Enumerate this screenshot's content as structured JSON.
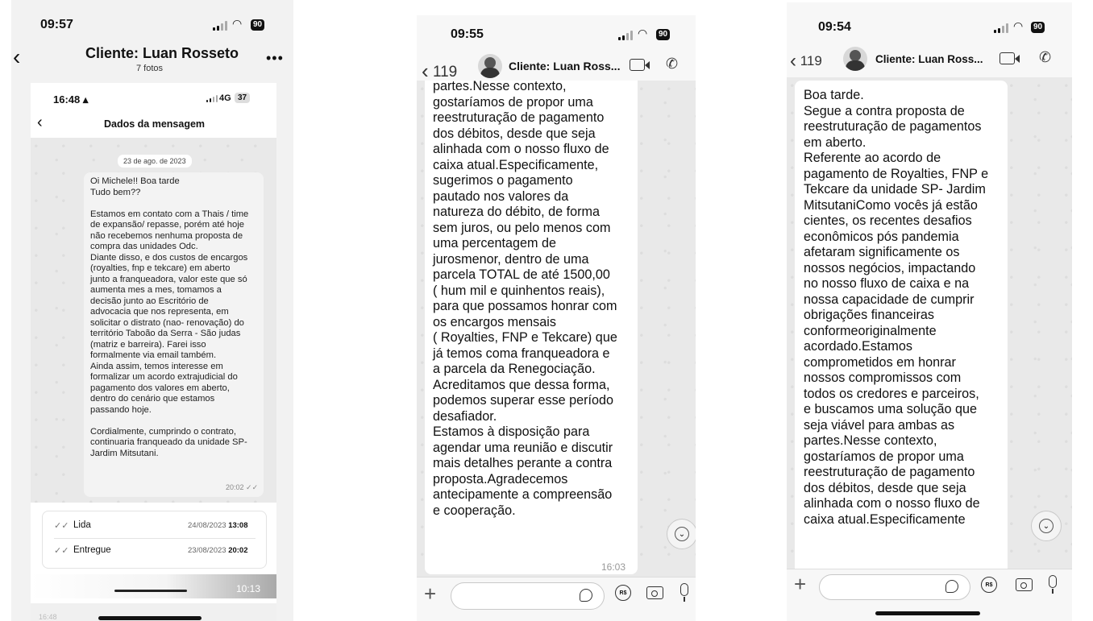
{
  "left": {
    "status_time": "09:57",
    "battery": "90",
    "nav_title": "Cliente: Luan Rosseto",
    "nav_subtitle": "7 fotos",
    "inner": {
      "status_time": "16:48",
      "network": "4G",
      "battery": "37",
      "title": "Dados da mensagem",
      "date_chip": "23 de ago. de 2023",
      "message_lines": [
        "Oi Michele!! Boa tarde",
        "Tudo bem??",
        "",
        "Estamos em contato com a Thais / time",
        "de expansão/ repasse, porém até hoje",
        "não recebemos nenhuma proposta de",
        "compra das unidades Odc.",
        "Diante disso, e dos custos de encargos",
        "(royalties, fnp e tekcare) em aberto",
        "junto a franqueadora, valor este que só",
        "aumenta mes a mes, tomamos a",
        "decisão junto ao Escritório de",
        "advocacia que nos representa, em",
        "solicitar o distrato (nao- renovação) do",
        "território Taboão da Serra - São judas",
        "(matriz e barreira). Farei isso",
        "formalmente via email também.",
        "Ainda assim, temos interesse em",
        "formalizar um acordo extrajudicial do",
        "pagamento dos valores em aberto,",
        "dentro do cenário que estamos",
        "passando hoje.",
        "",
        "Cordialmente, cumprindo o contrato,",
        "continuaria franqueado da unidade SP-",
        "Jardim Mitsutani."
      ],
      "message_time": "20:02",
      "read_label": "Lida",
      "read_date": "24/08/2023",
      "read_time": "13:08",
      "delivered_label": "Entregue",
      "delivered_date": "23/08/2023",
      "delivered_time": "20:02",
      "video_time": "10:13",
      "bottom_time": "16:48"
    }
  },
  "middle": {
    "status_time": "09:55",
    "battery": "90",
    "back_count": "119",
    "contact": "Cliente: Luan Ross...",
    "message_lines": [
      "partes.Nesse contexto,",
      "gostaríamos de propor uma",
      "reestruturação de pagamento",
      "dos débitos, desde que seja",
      "alinhada com o nosso fluxo de",
      "caixa atual.Especificamente,",
      "sugerimos o pagamento",
      "pautado nos valores da",
      "natureza do débito, de forma",
      "sem juros, ou pelo menos com",
      "uma percentagem de",
      "jurosmenor, dentro de uma",
      "parcela TOTAL de até 1500,00",
      "( hum mil e quinhentos reais),",
      "para que possamos honrar com",
      "os encargos mensais",
      "( Royalties, FNP e Tekcare) que",
      "já temos coma franqueadora e",
      "a parcela da Renegociação.",
      "Acreditamos que dessa forma,",
      "podemos superar esse período",
      "desafiador.",
      "Estamos à disposição para",
      "agendar uma reunião e discutir",
      "mais detalhes perante a contra",
      "proposta.Agradecemos",
      "antecipamente a compreensão",
      "e cooperação."
    ],
    "message_time": "16:03"
  },
  "right": {
    "status_time": "09:54",
    "battery": "90",
    "back_count": "119",
    "contact": "Cliente: Luan Ross...",
    "message_lines": [
      "Boa tarde.",
      "Segue a contra proposta de",
      "reestruturação de pagamentos",
      "em aberto.",
      "Referente ao acordo de",
      "pagamento de Royalties, FNP  e",
      "Tekcare da unidade SP- Jardim",
      "MitsutaniComo vocês já estão",
      "cientes, os recentes desafios",
      "econômicos pós pandemia",
      "afetaram significamente os",
      "nossos negócios, impactando",
      "no nosso fluxo de caixa e na",
      "nossa capacidade de cumprir",
      "obrigações financeiras",
      "conformeoriginalmente",
      "acordado.Estamos",
      "comprometidos em honrar",
      "nossos compromissos com",
      "todos os credores e parceiros,",
      "e buscamos uma solução que",
      "seja viável para ambas as",
      "partes.Nesse contexto,",
      "gostaríamos de propor uma",
      "reestruturação de pagamento",
      "dos débitos, desde que seja",
      "alinhada com o nosso fluxo de",
      "caixa atual.Especificamente"
    ]
  }
}
